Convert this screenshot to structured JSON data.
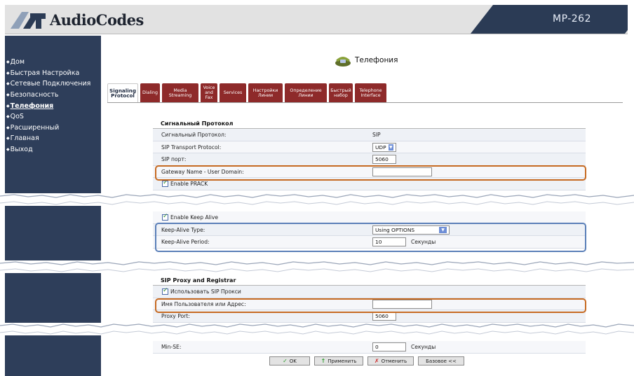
{
  "header": {
    "brand": "AudioCodes",
    "model": "MP-262"
  },
  "sidebar": {
    "items": [
      {
        "label": "Дом",
        "active": false
      },
      {
        "label": "Быстрая Настройка",
        "active": false
      },
      {
        "label": "Сетевые Подключения",
        "active": false
      },
      {
        "label": "Безопасность",
        "active": false
      },
      {
        "label": "Телефония",
        "active": true
      },
      {
        "label": "QoS",
        "active": false
      },
      {
        "label": "Расширенный",
        "active": false
      },
      {
        "label": "Главная",
        "active": false
      },
      {
        "label": "Выход",
        "active": false
      }
    ]
  },
  "page": {
    "title": "Телефония",
    "icon": "telephone-icon"
  },
  "tabs": [
    {
      "label": "Signaling Protocol",
      "active": true
    },
    {
      "label": "Dialing",
      "active": false
    },
    {
      "label": "Media Streaming",
      "active": false
    },
    {
      "label": "Voice and Fax",
      "active": false
    },
    {
      "label": "Services",
      "active": false
    },
    {
      "label": "Настройки Линии",
      "active": false
    },
    {
      "label": "Определение Линии",
      "active": false
    },
    {
      "label": "Быстрый набор",
      "active": false
    },
    {
      "label": "Telephone Interface",
      "active": false
    }
  ],
  "signaling": {
    "section_title": "Сигнальный Протокол",
    "protocol_label": "Сигнальный Протокол:",
    "protocol_value": "SIP",
    "transport_label": "SIP Transport Protocol:",
    "transport_value": "UDP",
    "port_label": "SIP порт:",
    "port_value": "5060",
    "gateway_label": "Gateway Name - User Domain:",
    "gateway_value": "",
    "prack_label": "Enable PRACK"
  },
  "keepalive": {
    "enable_label": "Enable Keep Alive",
    "type_label": "Keep-Alive Type:",
    "type_value": "Using OPTIONS",
    "period_label": "Keep-Alive Period:",
    "period_value": "10",
    "period_unit": "Секунды"
  },
  "proxy": {
    "section_title": "SIP Proxy and Registrar",
    "use_proxy_label": "Использовать SIP Прокси",
    "user_label": "Имя Пользователя или Адрес:",
    "user_value": "",
    "port_label": "Proxy Port:",
    "port_value": "5060",
    "minse_label": "Min-SE:",
    "minse_value": "0",
    "minse_unit": "Секунды"
  },
  "buttons": {
    "ok": "OK",
    "apply": "Применить",
    "cancel": "Отменить",
    "basic": "Базовое <<"
  },
  "colors": {
    "sidebar": "#2e3e5a",
    "tab": "#8e2a2a",
    "highlight_orange": "#c66a22",
    "highlight_blue": "#5a7fb8"
  }
}
